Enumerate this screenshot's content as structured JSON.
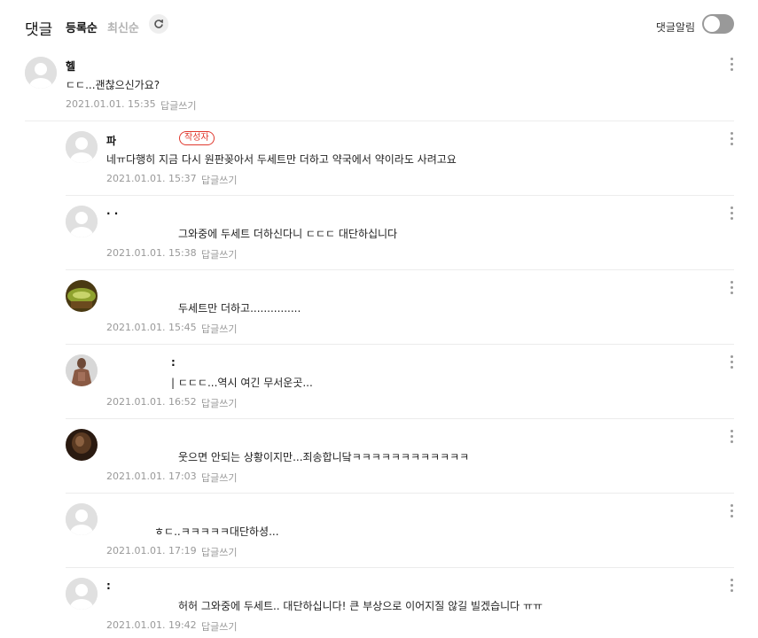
{
  "header": {
    "title": "댓글",
    "sort_registered": "등록순",
    "sort_latest": "최신순",
    "alarm_label": "댓글알림",
    "refresh_icon": "refresh-icon",
    "more_icon": "more-vertical-icon"
  },
  "comments": [
    {
      "nick": "헬",
      "text": "ㄷㄷ...괜찮으신가요?",
      "date": "2021.01.01. 15:35",
      "reply": "답글쓰기"
    },
    {
      "nick": "파",
      "badge": "작성자",
      "text": "네ㅠ다행히 지금 다시 원판꽂아서 두세트만 더하고 약국에서 약이라도 사려고요",
      "date": "2021.01.01. 15:37",
      "reply": "답글쓰기"
    },
    {
      "nick": "·  ·",
      "text": "그와중에 두세트 더하신다니 ㄷㄷㄷ 대단하십니다",
      "date": "2021.01.01. 15:38",
      "reply": "답글쓰기"
    },
    {
      "nick": "",
      "text": "두세트만 더하고...............",
      "date": "2021.01.01. 15:45",
      "reply": "답글쓰기"
    },
    {
      "nick": ":",
      "text": "| ㄷㄷㄷ...역시 여긴 무서운곳...",
      "date": "2021.01.01. 16:52",
      "reply": "답글쓰기"
    },
    {
      "nick": "",
      "text": "웃으면 안되는 상황이지만...죄송합니닼ㅋㅋㅋㅋㅋㅋㅋㅋㅋㅋㅋㅋ",
      "date": "2021.01.01. 17:03",
      "reply": "답글쓰기"
    },
    {
      "nick": "",
      "text": "ㅎㄷ..ㅋㅋㅋㅋㅋ대단하셩...",
      "date": "2021.01.01. 17:19",
      "reply": "답글쓰기"
    },
    {
      "nick": ":",
      "text": "허허 그와중에 두세트.. 대단하십니다! 큰 부상으로 이어지질 않길 빌겠습니다 ㅠㅠ",
      "date": "2021.01.01. 19:42",
      "reply": "답글쓰기"
    }
  ]
}
